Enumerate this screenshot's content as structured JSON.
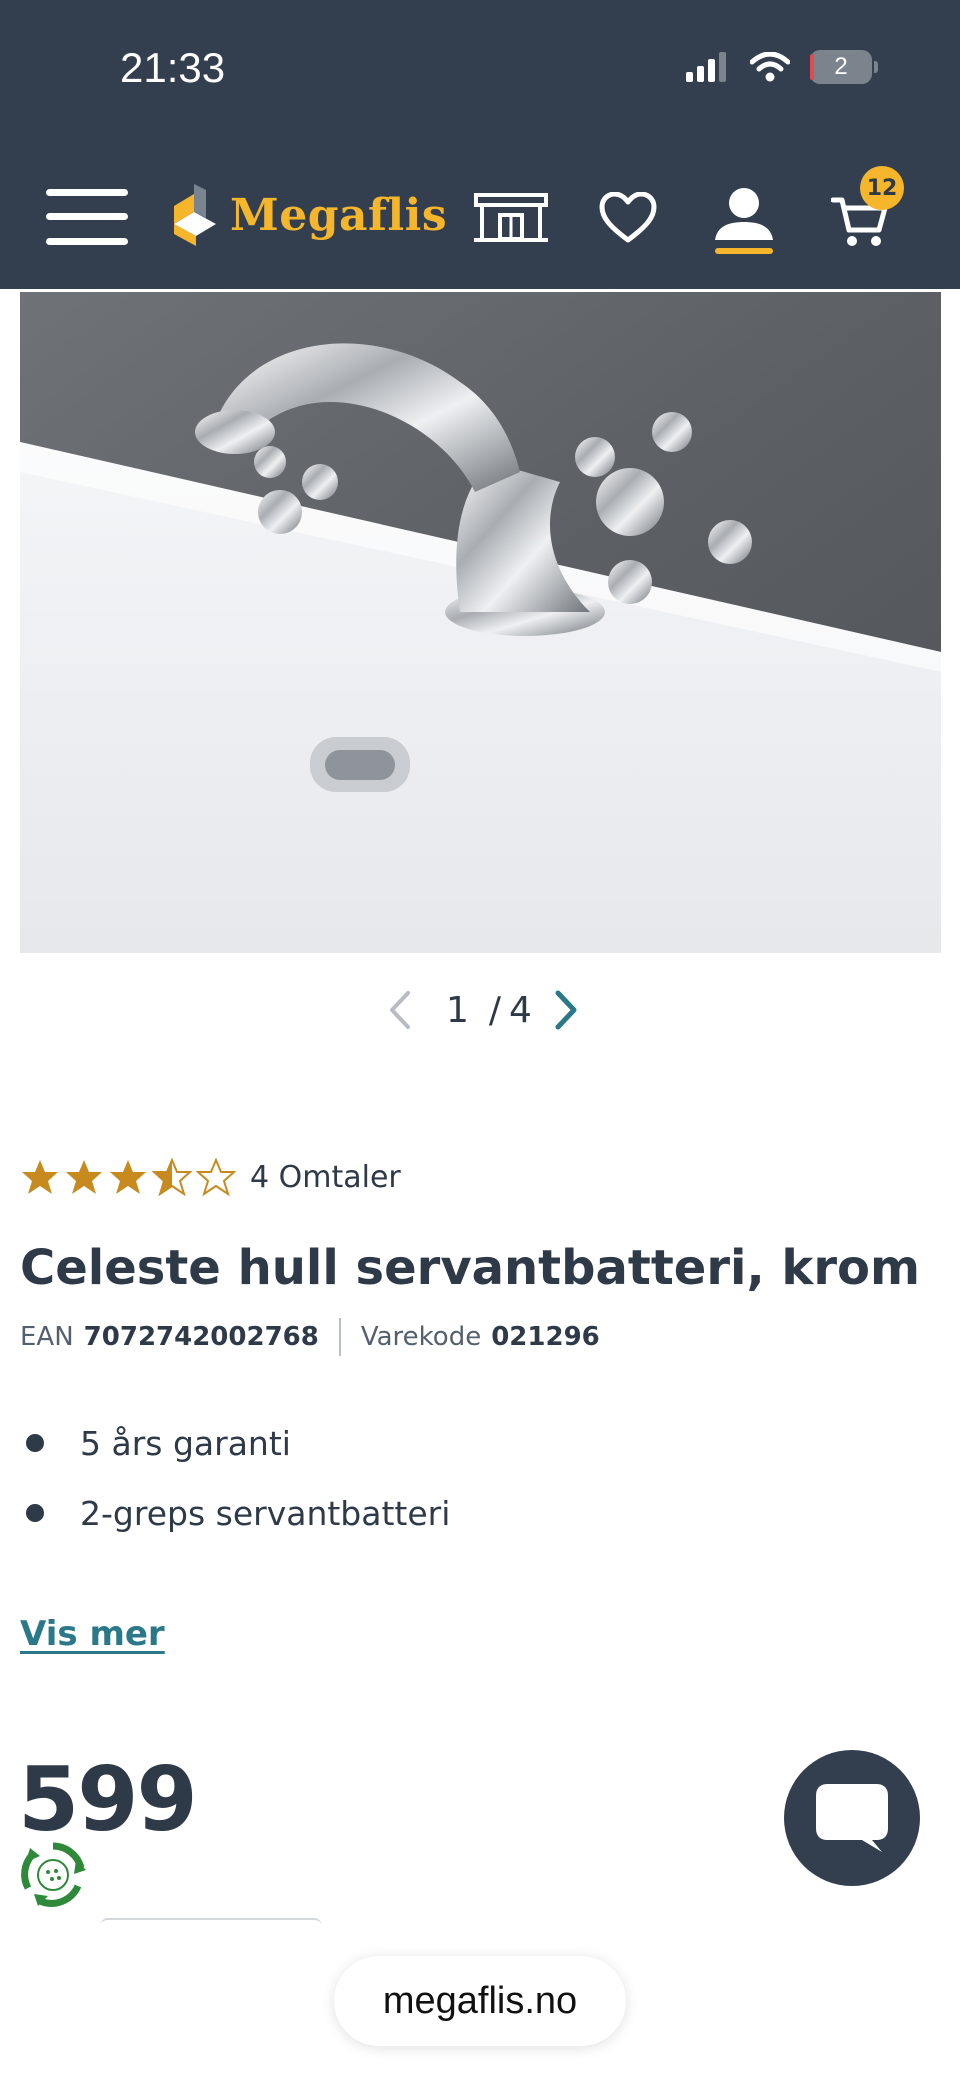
{
  "status_bar": {
    "time": "21:33",
    "battery_level": "2"
  },
  "header": {
    "brand": "Megaflis",
    "cart_count": "12",
    "icons": [
      "menu-icon",
      "megaflis-logo-mark",
      "store-icon",
      "heart-icon",
      "user-icon",
      "cart-icon"
    ]
  },
  "gallery": {
    "current": "1",
    "separator": "/",
    "total": "4"
  },
  "product": {
    "rating": 3.5,
    "rating_max": 5,
    "reviews_label": "4 Omtaler",
    "title": "Celeste hull servantbatteri, krom",
    "ean_label": "EAN",
    "ean_value": "7072742002768",
    "sku_label": "Varekode",
    "sku_value": "021296",
    "features": [
      "5 års garanti",
      "2-greps servantbatteri"
    ],
    "show_more": "Vis mer",
    "price": "599"
  },
  "browser": {
    "url": "megaflis.no"
  },
  "colors": {
    "header_bg": "#333f4e",
    "accent_yellow": "#f5b62b",
    "link_teal": "#2a7888",
    "star_gold": "#c68a1e"
  }
}
